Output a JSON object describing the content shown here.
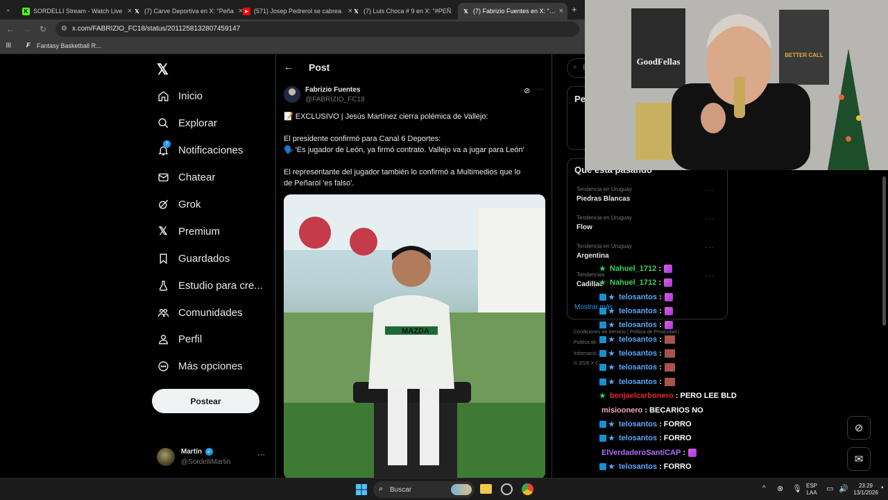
{
  "browser": {
    "tabs": [
      {
        "title": "SORDELLI Stream - Watch Live",
        "active": false
      },
      {
        "title": "(7) Carve Deportiva en X: \"Peña",
        "active": false
      },
      {
        "title": "(571) Josep Pedrerol se cabrea",
        "active": false
      },
      {
        "title": "(7) Luis Choca # 9 en X: \"#PEÑ",
        "active": false
      },
      {
        "title": "(7) Fabrizio Fuentes en X: \"📝 E",
        "active": true
      }
    ],
    "url": "x.com/FABRIZIO_FC18/status/2011258132807459147",
    "bookmark": "Fantasy Basketball R..."
  },
  "nav": {
    "items": [
      {
        "label": "Inicio",
        "icon": "home-icon"
      },
      {
        "label": "Explorar",
        "icon": "search-icon"
      },
      {
        "label": "Notificaciones",
        "icon": "bell-icon",
        "badge": "7"
      },
      {
        "label": "Chatear",
        "icon": "mail-icon"
      },
      {
        "label": "Grok",
        "icon": "grok-icon"
      },
      {
        "label": "Premium",
        "icon": "x-logo-icon"
      },
      {
        "label": "Guardados",
        "icon": "bookmark-icon"
      },
      {
        "label": "Estudio para cre...",
        "icon": "flask-icon"
      },
      {
        "label": "Comunidades",
        "icon": "people-icon"
      },
      {
        "label": "Perfil",
        "icon": "person-icon"
      },
      {
        "label": "Más opciones",
        "icon": "more-circle-icon"
      }
    ],
    "post_button": "Postear",
    "user": {
      "name": "Martín",
      "handle": "@SordelliMartin"
    }
  },
  "post": {
    "header": "Post",
    "author": "Fabrizio Fuentes",
    "handle": "@FABRIZIO_FC18",
    "line1": "📝 EXCLUSIVO | Jesús Martínez cierra polémica de Vallejo:",
    "line2": "El presidente confirmó para Canal 6 Deportes:",
    "line3": "🗣️ 'Es jugador de León, ya firmó contrato. Vallejo va a jugar para León'",
    "line4": "El representante del jugador también lo confirmó a Multimedios que lo",
    "line5": "de Peñarol 'es falso'."
  },
  "sidebar": {
    "search_stub": "B",
    "premium_stub": "Pe",
    "trending_title": "Qué está pasando",
    "trends": [
      {
        "context": "Tendencia en Uruguay",
        "name": "Piedras Blancas"
      },
      {
        "context": "Tendencia en Uruguay",
        "name": "Flow"
      },
      {
        "context": "Tendencia en Uruguay",
        "name": "Argentina"
      },
      {
        "context": "Tendencias",
        "name": "Cadillac"
      }
    ],
    "show_more": "Mostrar más",
    "footer1": "Condiciones de Servicio  |  Política de Privacidad  |",
    "footer2": "Política de ...",
    "footer3": "Informació...",
    "footer4": "© 2026 X C..."
  },
  "chat": [
    {
      "user": "Nahuel_1712",
      "color": "#3ad45a",
      "msg": "",
      "badge": "star",
      "emote": "pink"
    },
    {
      "user": "Nahuel_1712",
      "color": "#3ad45a",
      "msg": "",
      "badge": "star",
      "emote": "pink"
    },
    {
      "user": "telosantos",
      "color": "#5aa9ff",
      "msg": "",
      "badge": "prime",
      "emote": "pink"
    },
    {
      "user": "telosantos",
      "color": "#5aa9ff",
      "msg": "",
      "badge": "prime",
      "emote": "pink"
    },
    {
      "user": "telosantos",
      "color": "#5aa9ff",
      "msg": "",
      "badge": "prime",
      "emote": "pink"
    },
    {
      "user": "telosantos",
      "color": "#5aa9ff",
      "msg": "",
      "badge": "prime",
      "emote": "face"
    },
    {
      "user": "telosantos",
      "color": "#5aa9ff",
      "msg": "",
      "badge": "prime",
      "emote": "face"
    },
    {
      "user": "telosantos",
      "color": "#5aa9ff",
      "msg": "",
      "badge": "prime",
      "emote": "face"
    },
    {
      "user": "telosantos",
      "color": "#5aa9ff",
      "msg": "",
      "badge": "prime",
      "emote": "face"
    },
    {
      "user": "benjaelcarbonero",
      "color": "#e0262e",
      "msg": "PERO LEE BLD",
      "badge": "star",
      "emote": ""
    },
    {
      "user": "misioonero",
      "color": "#f4a3c8",
      "msg": "BECARIOS NO",
      "badge": "none",
      "emote": ""
    },
    {
      "user": "telosantos",
      "color": "#5aa9ff",
      "msg": "FORRO",
      "badge": "prime",
      "emote": ""
    },
    {
      "user": "telosantos",
      "color": "#5aa9ff",
      "msg": "FORRO",
      "badge": "prime",
      "emote": ""
    },
    {
      "user": "ElVerdaderoSantiCAP",
      "color": "#b26bff",
      "msg": "",
      "badge": "none",
      "emote": "pink"
    },
    {
      "user": "telosantos",
      "color": "#5aa9ff",
      "msg": "FORRO",
      "badge": "prime",
      "emote": ""
    }
  ],
  "webcam": {
    "poster": "GoodFellas",
    "poster2": "BETTER CALL"
  },
  "taskbar": {
    "search": "Buscar",
    "lang1": "ESP",
    "lang2": "LAA",
    "time": "23:29",
    "date": "13/1/2026"
  },
  "colors": {
    "accent": "#1d9bf0",
    "background": "#000000",
    "text": "#e7e9ea",
    "muted": "#71767b"
  }
}
